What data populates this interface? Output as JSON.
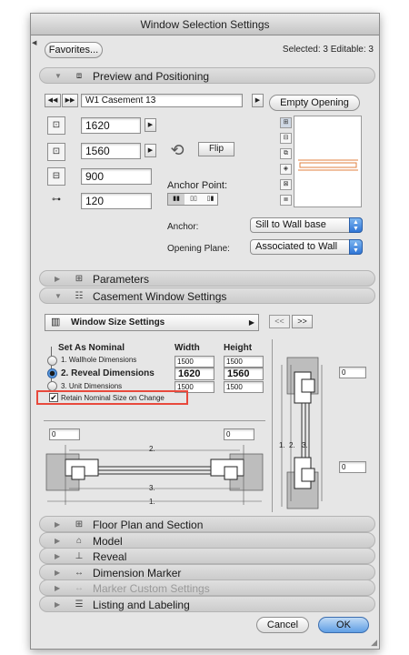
{
  "window": {
    "title": "Window Selection Settings"
  },
  "header": {
    "favorites_label": "Favorites...",
    "selection_info": "Selected: 3 Editable: 3"
  },
  "preview": {
    "section_label": "Preview and Positioning",
    "nav_prev": "◀◀",
    "nav_next": "▶▶",
    "element_name": "W1 Casement 13",
    "empty_opening_label": "Empty Opening",
    "width_value": "1620",
    "height_value": "1560",
    "sill_value": "900",
    "reveal_value": "120",
    "flip_label": "Flip",
    "anchor_point_label": "Anchor Point:",
    "anchor_label": "Anchor:",
    "anchor_value": "Sill to Wall base",
    "opening_plane_label": "Opening Plane:",
    "opening_plane_value": "Associated to Wall"
  },
  "parameters": {
    "section_label": "Parameters"
  },
  "casement": {
    "section_label": "Casement Window Settings",
    "page_selector": "Window Size Settings",
    "prev_btn": "<<",
    "next_btn": ">>",
    "set_as_nominal": "Set As Nominal",
    "col_width": "Width",
    "col_height": "Height",
    "rows": [
      {
        "label": "1. Wallhole Dimensions",
        "width": "1500",
        "height": "1500"
      },
      {
        "label": "2. Reveal Dimensions",
        "width": "1620",
        "height": "1560"
      },
      {
        "label": "3. Unit Dimensions",
        "width": "1500",
        "height": "1500"
      }
    ],
    "retain_label": "Retain Nominal Size on Change",
    "plan_left_value": "0",
    "plan_right_value": "0",
    "section_top_value": "0",
    "section_bottom_value": "0",
    "dim_2": "2.",
    "dim_3": "3.",
    "dim_1": "1."
  },
  "collapsed_sections": [
    {
      "label": "Floor Plan and Section",
      "icon": "floor-plan-icon"
    },
    {
      "label": "Model",
      "icon": "model-icon"
    },
    {
      "label": "Reveal",
      "icon": "reveal-icon"
    },
    {
      "label": "Dimension Marker",
      "icon": "dimension-marker-icon"
    },
    {
      "label": "Marker Custom Settings",
      "icon": "marker-custom-icon"
    },
    {
      "label": "Listing and Labeling",
      "icon": "listing-icon"
    }
  ],
  "footer": {
    "cancel_label": "Cancel",
    "ok_label": "OK"
  },
  "colors": {
    "highlight": "#e8493c",
    "accent_blue": "#3a7ee0",
    "preview_line": "#e08040"
  }
}
